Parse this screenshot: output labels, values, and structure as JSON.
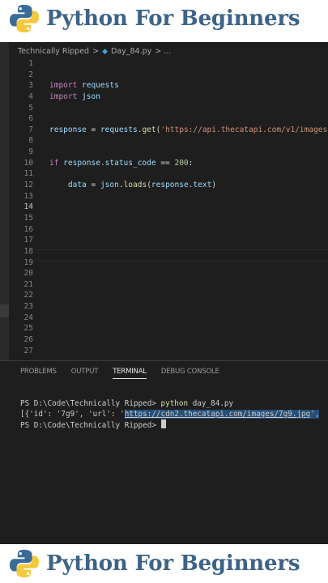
{
  "brand": {
    "title": "Python For Beginners"
  },
  "breadcrumb": {
    "folder": "Technically Ripped",
    "sep": ">",
    "file": "Day_84.py",
    "tail": "> ..."
  },
  "editor": {
    "line_numbers": [
      "1",
      "2",
      "3",
      "4",
      "5",
      "6",
      "7",
      "8",
      "9",
      "10",
      "11",
      "12",
      "13",
      "14",
      "15",
      "16",
      "17",
      "18",
      "19",
      "20",
      "21",
      "22",
      "23",
      "24",
      "25",
      "26",
      "27"
    ],
    "active_line": "14",
    "code": {
      "l3_kw": "import",
      "l3_mod": " requests",
      "l4_kw": "import",
      "l4_mod": " json",
      "l7_var": "response",
      "l7_op": " = ",
      "l7_obj": "requests",
      "l7_dot": ".",
      "l7_fn": "get",
      "l7_paren": "(",
      "l7_str": "'https://api.thecatapi.com/v1/images",
      "l10_kw": "if",
      "l10_var": " response",
      "l10_dot": ".",
      "l10_attr": "status_code",
      "l10_op": " == ",
      "l10_num": "200",
      "l10_colon": ":",
      "l12_var": "data",
      "l12_op": " = ",
      "l12_obj": "json",
      "l12_dot": ".",
      "l12_fn": "loads",
      "l12_paren": "(",
      "l12_arg": "response",
      "l12_dot2": ".",
      "l12_attr": "text",
      "l12_close": ")"
    }
  },
  "panel": {
    "tabs": [
      "PROBLEMS",
      "OUTPUT",
      "TERMINAL",
      "DEBUG CONSOLE"
    ],
    "active_tab": "TERMINAL",
    "terminal": {
      "line1_prompt": "PS D:\\Code\\Technically Ripped> ",
      "line1_cmd": "python",
      "line1_arg": " day_84.py",
      "line2_pre": "[{'id': '7g9', 'url': '",
      "line2_url": "https://cdn2.thecatapi.com/images/7g9.jpg",
      "line2_post": "',",
      "line3_prompt": "PS D:\\Code\\Technically Ripped> "
    }
  }
}
